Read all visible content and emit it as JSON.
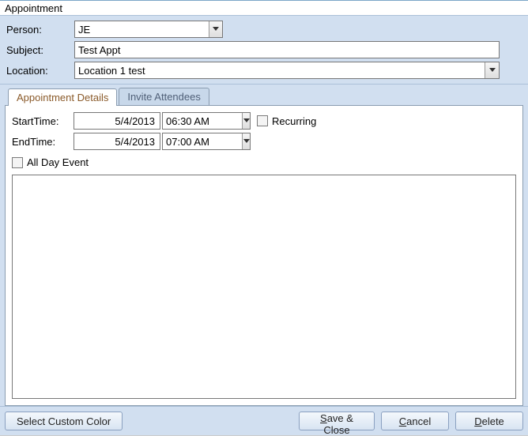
{
  "window": {
    "title": "Appointment"
  },
  "header": {
    "person_label": "Person:",
    "person_value": "JE",
    "subject_label": "Subject:",
    "subject_value": "Test Appt",
    "location_label": "Location:",
    "location_value": "Location 1 test"
  },
  "tabs": {
    "details": "Appointment Details",
    "attendees": "Invite Attendees"
  },
  "details": {
    "start_label": "StartTime:",
    "start_date": "5/4/2013",
    "start_time": "06:30 AM",
    "end_label": "EndTime:",
    "end_date": "5/4/2013",
    "end_time": "07:00 AM",
    "recurring_label": "Recurring",
    "allday_label": "All Day Event",
    "notes": ""
  },
  "footer": {
    "custom_color": "Select Custom Color",
    "save_close_pre": "S",
    "save_close_post": "ave & Close",
    "cancel_pre": "C",
    "cancel_post": "ancel",
    "delete_pre": "D",
    "delete_post": "elete"
  }
}
